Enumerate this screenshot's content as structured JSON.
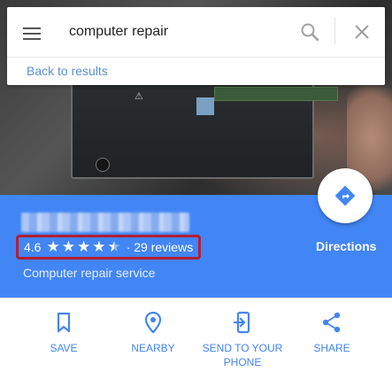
{
  "search": {
    "query": "computer repair",
    "back_label": "Back to results"
  },
  "place": {
    "name_redacted": true,
    "rating": "4.6",
    "rating_value": 4.6,
    "reviews_label": "· 29 reviews",
    "category": "Computer repair service",
    "directions_label": "Directions"
  },
  "actions": [
    {
      "label": "SAVE",
      "icon": "bookmark-icon"
    },
    {
      "label": "NEARBY",
      "icon": "location-pin-icon"
    },
    {
      "label": "SEND TO YOUR PHONE",
      "icon": "send-to-phone-icon"
    },
    {
      "label": "SHARE",
      "icon": "share-icon"
    }
  ],
  "colors": {
    "accent": "#4285f4",
    "highlight_border": "#b41e34"
  }
}
